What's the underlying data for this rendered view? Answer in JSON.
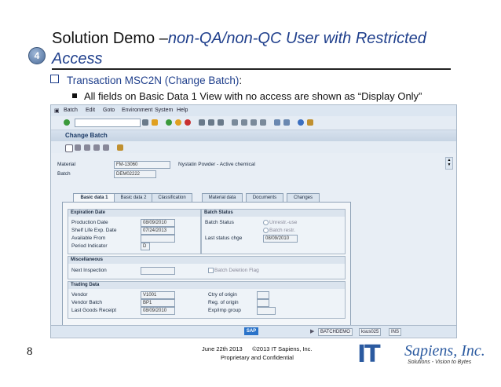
{
  "slide": {
    "badge": "4",
    "title_plain": "Solution Demo –",
    "title_italic": "non-QA/non-QC User with Restricted",
    "title_line2": "Access",
    "bullet1_prefix": "Transaction MSC2N (Change Batch)",
    "bullet1_suffix": ":",
    "bullet2": "All fields on Basic Data 1 View with no access are shown as “Display Only”",
    "page_number": "8",
    "footer_date": "June 22th 2013",
    "footer_copyright": "©2013 IT Sapiens, Inc.",
    "footer_confidential": "Proprietary and Confidential",
    "logo_it": "IT",
    "logo_name": "Sapiens, Inc.",
    "logo_tagline": "Solutions - Vision to Bytes"
  },
  "sap": {
    "menu": [
      "Batch",
      "Edit",
      "Goto",
      "Environment",
      "System",
      "Help"
    ],
    "screen_title": "Change Batch",
    "material_label": "Material",
    "material_value": "FM-13060",
    "material_desc": "Nystatin Powder - Active chemical",
    "batch_label": "Batch",
    "batch_value": "DEM02222",
    "tabs": [
      "Basic data 1",
      "Basic data 2",
      "Classification",
      "Material data",
      "Documents",
      "Changes"
    ],
    "expiration": {
      "header": "Expiration Date",
      "production_label": "Production Date",
      "production_value": "08/09/2010",
      "shelf_label": "Shelf Life Exp. Date",
      "shelf_value": "07/24/2013",
      "available_label": "Available From",
      "period_label": "Period Indicator",
      "period_value": "D"
    },
    "batch_status": {
      "header": "Batch Status",
      "status_label": "Batch Status",
      "opt1": "Unrestr.-use",
      "opt2": "Batch restr.",
      "last_change_label": "Last status chge",
      "last_change_value": "08/09/2010"
    },
    "misc": {
      "header": "Miscellaneous",
      "next_inspection_label": "Next Inspection",
      "deletion_flag_label": "Batch Deletion Flag"
    },
    "trading": {
      "header": "Trading Data",
      "vendor_label": "Vendor",
      "vendor_value": "V1001",
      "vendor_batch_label": "Vendor Batch",
      "vendor_batch_value": "BP1",
      "last_receipt_label": "Last Goods Receipt",
      "last_receipt_value": "08/09/2010",
      "ctry_label": "Ctry of origin",
      "reg_label": "Reg. of origin",
      "exp_group_label": "Exp/imp group"
    },
    "status_bar": {
      "sap_logo": "SAP",
      "transaction": "BATCHDEMO",
      "server": "ksus025",
      "mode": "INS"
    }
  }
}
